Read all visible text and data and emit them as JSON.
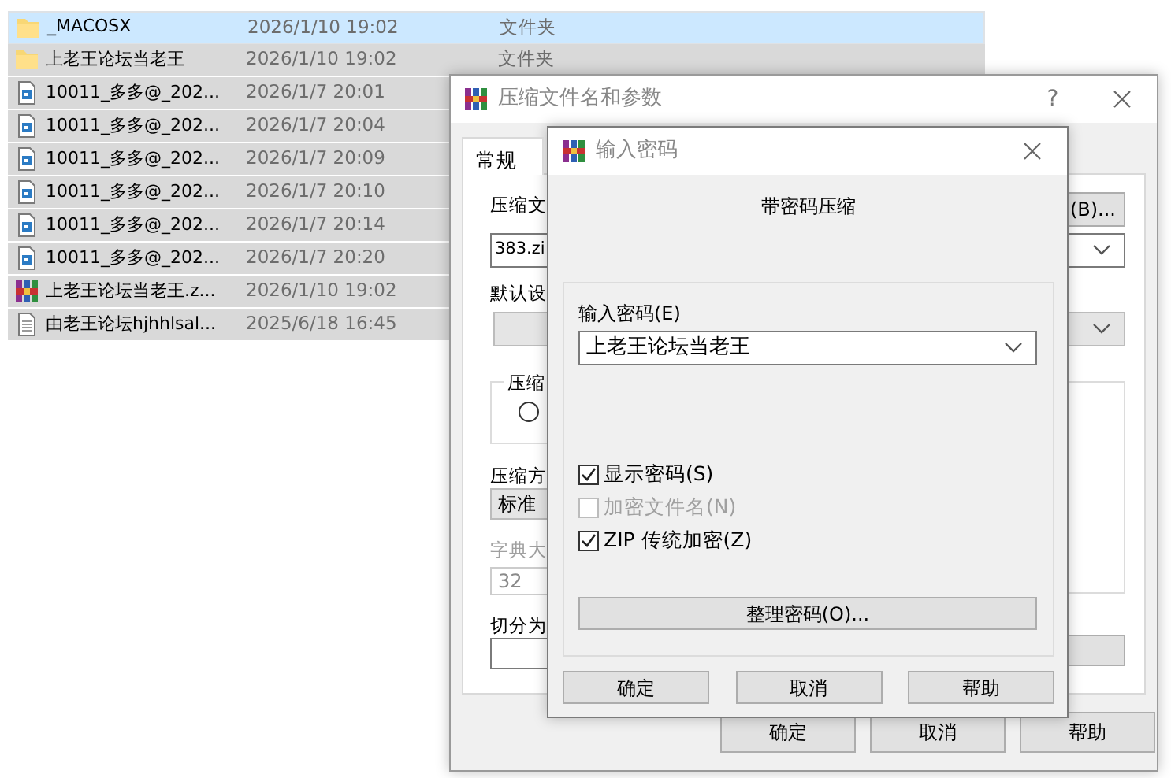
{
  "file_list": {
    "rows": [
      {
        "kind": "folder",
        "name": "_MACOSX",
        "date": "2026/1/10 19:02",
        "type": "文件夹",
        "selected": true,
        "focused": true
      },
      {
        "kind": "folder",
        "name": "上老王论坛当老王",
        "date": "2026/1/10 19:02",
        "type": "文件夹",
        "selected": true,
        "focused": false
      },
      {
        "kind": "media",
        "name": "10011_多多@_202...",
        "date": "2026/1/7 20:01",
        "selected": true,
        "focused": false
      },
      {
        "kind": "media",
        "name": "10011_多多@_202...",
        "date": "2026/1/7 20:04",
        "selected": true,
        "focused": false
      },
      {
        "kind": "media",
        "name": "10011_多多@_202...",
        "date": "2026/1/7 20:09",
        "selected": true,
        "focused": false
      },
      {
        "kind": "media",
        "name": "10011_多多@_202...",
        "date": "2026/1/7 20:10",
        "selected": true,
        "focused": false
      },
      {
        "kind": "media",
        "name": "10011_多多@_202...",
        "date": "2026/1/7 20:14",
        "selected": true,
        "focused": false
      },
      {
        "kind": "media",
        "name": "10011_多多@_202...",
        "date": "2026/1/7 20:20",
        "selected": true,
        "focused": false
      },
      {
        "kind": "archive",
        "name": "上老王论坛当老王.z...",
        "date": "2026/1/10 19:02",
        "selected": true,
        "focused": false
      },
      {
        "kind": "text",
        "name": "由老王论坛hjhhlsal...",
        "date": "2025/6/18 16:45",
        "selected": true,
        "focused": false
      }
    ]
  },
  "archive_dialog": {
    "title": "压缩文件名和参数",
    "help": "?",
    "tabs": [
      {
        "label": "常规",
        "selected": true
      }
    ],
    "archive_name_label": "压缩文",
    "archive_name_value": "383.zi",
    "browse_button": "(B)...",
    "profile_label": "默认设",
    "format_group_label": "压缩",
    "format_radio": {
      "selected": false
    },
    "method_label": "压缩方",
    "method_value": "标准",
    "dictionary_label": "字典大",
    "dictionary_value": "32",
    "dictionary_disabled": true,
    "split_label": "切分为",
    "buttons": [
      "确定",
      "取消",
      "帮助"
    ]
  },
  "password_dialog": {
    "title": "输入密码",
    "heading": "带密码压缩",
    "password_label": "输入密码(E)",
    "password_value": "上老王论坛当老王",
    "options": [
      {
        "label": "显示密码(S)",
        "checked": true,
        "disabled": false
      },
      {
        "label": "加密文件名(N)",
        "checked": false,
        "disabled": true
      },
      {
        "label": "ZIP 传统加密(Z)",
        "checked": true,
        "disabled": false
      }
    ],
    "manage_button": "整理密码(O)...",
    "buttons": [
      "确定",
      "取消",
      "帮助"
    ]
  }
}
